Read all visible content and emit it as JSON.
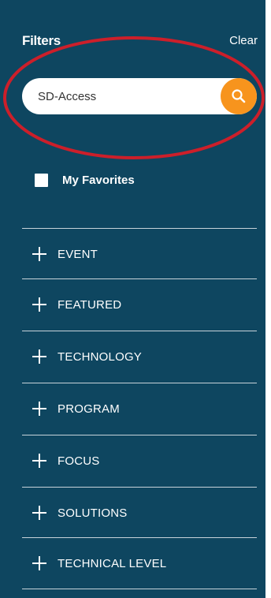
{
  "header": {
    "title": "Filters",
    "clear_label": "Clear"
  },
  "search": {
    "value": "SD-Access",
    "placeholder": "",
    "icon": "search-icon"
  },
  "favorites": {
    "label": "My Favorites",
    "checked": false
  },
  "categories": [
    {
      "label": "EVENT"
    },
    {
      "label": "FEATURED"
    },
    {
      "label": "TECHNOLOGY"
    },
    {
      "label": "PROGRAM"
    },
    {
      "label": "FOCUS"
    },
    {
      "label": "SOLUTIONS"
    },
    {
      "label": "TECHNICAL LEVEL"
    }
  ],
  "colors": {
    "panel_background": "#0e4660",
    "search_button": "#f7941d",
    "highlight_annotation": "#cc1f2a",
    "text": "#ffffff"
  }
}
